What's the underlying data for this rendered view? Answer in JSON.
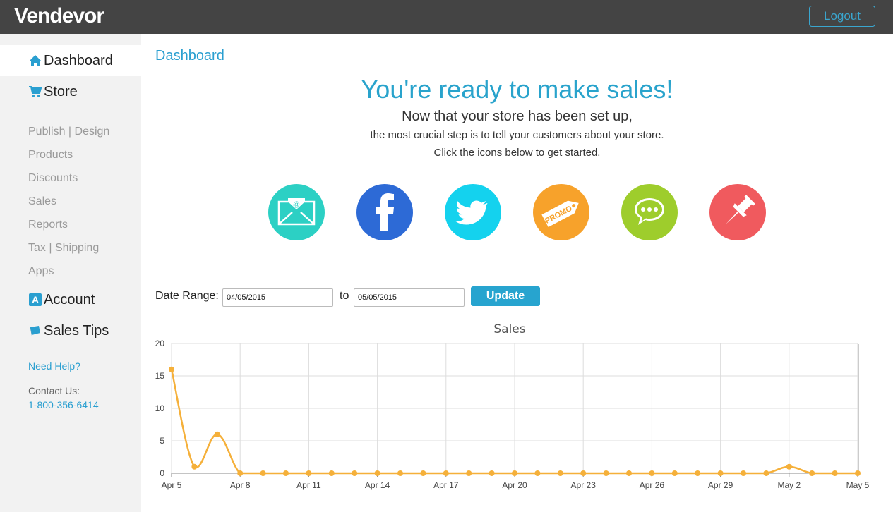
{
  "brand": {
    "logo_text": "Vendevor",
    "logout_label": "Logout"
  },
  "sidebar": {
    "main_items": [
      {
        "label": "Dashboard",
        "icon": "home-icon"
      },
      {
        "label": "Store",
        "icon": "cart-icon"
      },
      {
        "label": "Account",
        "icon": "account-icon"
      },
      {
        "label": "Sales Tips",
        "icon": "book-icon"
      }
    ],
    "sub_items": [
      "Publish | Design",
      "Products",
      "Discounts",
      "Sales",
      "Reports",
      "Tax | Shipping",
      "Apps"
    ],
    "help_link": "Need Help?",
    "contact_label": "Contact Us:",
    "phone": "1-800-356-6414"
  },
  "main": {
    "breadcrumb": "Dashboard",
    "headline": "You're ready to make sales!",
    "line1": "Now that your store has been set up,",
    "line2": "the most crucial step is to tell your customers about your store.",
    "line3": "Click the icons below to get started.",
    "share_icons": [
      {
        "name": "email-icon",
        "color": "#2cd0c4"
      },
      {
        "name": "facebook-icon",
        "color": "#2d6ad6"
      },
      {
        "name": "twitter-icon",
        "color": "#14d2ee"
      },
      {
        "name": "promo-tag-icon",
        "color": "#f7a22b",
        "text": "PROMO"
      },
      {
        "name": "chat-icon",
        "color": "#9ecd2c"
      },
      {
        "name": "pin-icon",
        "color": "#f05a5e"
      }
    ]
  },
  "date_range": {
    "label": "Date Range:",
    "from": "04/05/2015",
    "to_label": "to",
    "to": "05/05/2015",
    "update_label": "Update"
  },
  "chart_data": {
    "type": "line",
    "title": "Sales",
    "xlabel": "",
    "ylabel": "",
    "ylim": [
      0,
      20
    ],
    "yticks": [
      0,
      5,
      10,
      15,
      20
    ],
    "xtick_labels": [
      "Apr 5",
      "Apr 8",
      "Apr 11",
      "Apr 14",
      "Apr 17",
      "Apr 20",
      "Apr 23",
      "Apr 26",
      "Apr 29",
      "May 2",
      "May 5"
    ],
    "x": [
      "Apr 5",
      "Apr 6",
      "Apr 7",
      "Apr 8",
      "Apr 9",
      "Apr 10",
      "Apr 11",
      "Apr 12",
      "Apr 13",
      "Apr 14",
      "Apr 15",
      "Apr 16",
      "Apr 17",
      "Apr 18",
      "Apr 19",
      "Apr 20",
      "Apr 21",
      "Apr 22",
      "Apr 23",
      "Apr 24",
      "Apr 25",
      "Apr 26",
      "Apr 27",
      "Apr 28",
      "Apr 29",
      "Apr 30",
      "May 1",
      "May 2",
      "May 3",
      "May 4",
      "May 5"
    ],
    "series": [
      {
        "values": [
          16,
          1,
          6,
          0,
          0,
          0,
          0,
          0,
          0,
          0,
          0,
          0,
          0,
          0,
          0,
          0,
          0,
          0,
          0,
          0,
          0,
          0,
          0,
          0,
          0,
          0,
          0,
          1,
          0,
          0,
          0
        ],
        "color": "#f5b03a"
      }
    ],
    "grid": true,
    "legend": "none"
  }
}
